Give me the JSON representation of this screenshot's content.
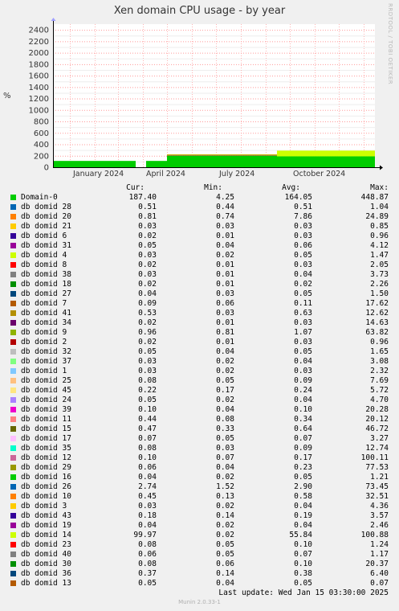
{
  "title": "Xen domain CPU usage - by year",
  "side_label": "RRDTOOL / TOBI OETIKER",
  "footer": "Munin 2.0.33-1",
  "last_update": "Last update:  Wed Jan 15 03:30:00 2025",
  "chart_data": {
    "type": "area",
    "ylabel": "%",
    "ylim": [
      0,
      2500
    ],
    "yticks": [
      0,
      200,
      400,
      600,
      800,
      1000,
      1200,
      1400,
      1600,
      1800,
      2000,
      2200,
      2400
    ],
    "xlim": [
      "2023-12-11",
      "2025-01-15"
    ],
    "xticks": [
      {
        "label": "January 2024",
        "date": "2024-01-01"
      },
      {
        "label": "April 2024",
        "date": "2024-04-01"
      },
      {
        "label": "July 2024",
        "date": "2024-07-01"
      },
      {
        "label": "October 2024",
        "date": "2024-10-01"
      }
    ],
    "grid": true,
    "colors": {
      "background": "#ffffff",
      "grid": "#ff9a9a",
      "domain0": "#00cc00",
      "domid14": "#ccff00",
      "domid6": "#00008f",
      "domid7": "#ccaa00"
    },
    "series_segments": [
      {
        "name": "Domain-0",
        "from": "2023-12-11",
        "to": "2024-03-23",
        "value": 110
      },
      {
        "name": "Domain-0",
        "from": "2024-04-05",
        "to": "2024-05-01",
        "value": 110
      },
      {
        "name": "Domain-0",
        "from": "2024-05-01",
        "to": "2024-09-15",
        "value": 200
      },
      {
        "name": "Domain-0",
        "from": "2024-09-15",
        "to": "2025-01-15",
        "value": 190
      },
      {
        "name": "db domid 6",
        "from": "2024-05-01",
        "to": "2024-09-15",
        "value": 15
      },
      {
        "name": "db domid 14",
        "from": "2024-09-15",
        "to": "2025-01-15",
        "value": 100
      }
    ]
  },
  "legend": {
    "headers": [
      "Cur:",
      "Min:",
      "Avg:",
      "Max:"
    ],
    "rows": [
      {
        "name": "Domain-0",
        "color": "#00cc00",
        "cur": "187.40",
        "min": "4.25",
        "avg": "164.05",
        "max": "448.87"
      },
      {
        "name": "db domid 28",
        "color": "#0066b3",
        "cur": "0.51",
        "min": "0.44",
        "avg": "0.51",
        "max": "1.04"
      },
      {
        "name": "db domid 20",
        "color": "#ff8000",
        "cur": "0.81",
        "min": "0.74",
        "avg": "7.86",
        "max": "24.89"
      },
      {
        "name": "db domid 21",
        "color": "#ffcc00",
        "cur": "0.03",
        "min": "0.03",
        "avg": "0.03",
        "max": "0.85"
      },
      {
        "name": "db domid 6",
        "color": "#330099",
        "cur": "0.02",
        "min": "0.01",
        "avg": "0.03",
        "max": "0.96"
      },
      {
        "name": "db domid 31",
        "color": "#990099",
        "cur": "0.05",
        "min": "0.04",
        "avg": "0.06",
        "max": "4.12"
      },
      {
        "name": "db domid 4",
        "color": "#ccff00",
        "cur": "0.03",
        "min": "0.02",
        "avg": "0.05",
        "max": "1.47"
      },
      {
        "name": "db domid 8",
        "color": "#ff0000",
        "cur": "0.02",
        "min": "0.01",
        "avg": "0.03",
        "max": "2.05"
      },
      {
        "name": "db domid 38",
        "color": "#808080",
        "cur": "0.03",
        "min": "0.01",
        "avg": "0.04",
        "max": "3.73"
      },
      {
        "name": "db domid 18",
        "color": "#008f00",
        "cur": "0.02",
        "min": "0.01",
        "avg": "0.02",
        "max": "2.26"
      },
      {
        "name": "db domid 27",
        "color": "#00487d",
        "cur": "0.04",
        "min": "0.03",
        "avg": "0.05",
        "max": "1.50"
      },
      {
        "name": "db domid 7",
        "color": "#b35a00",
        "cur": "0.09",
        "min": "0.06",
        "avg": "0.11",
        "max": "17.62"
      },
      {
        "name": "db domid 41",
        "color": "#b38f00",
        "cur": "0.53",
        "min": "0.03",
        "avg": "0.63",
        "max": "12.62"
      },
      {
        "name": "db domid 34",
        "color": "#6b006b",
        "cur": "0.02",
        "min": "0.01",
        "avg": "0.03",
        "max": "14.63"
      },
      {
        "name": "db domid 9",
        "color": "#8fb300",
        "cur": "0.96",
        "min": "0.81",
        "avg": "1.07",
        "max": "63.82"
      },
      {
        "name": "db domid 2",
        "color": "#b30000",
        "cur": "0.02",
        "min": "0.01",
        "avg": "0.03",
        "max": "0.96"
      },
      {
        "name": "db domid 32",
        "color": "#bebebe",
        "cur": "0.05",
        "min": "0.04",
        "avg": "0.05",
        "max": "1.65"
      },
      {
        "name": "db domid 37",
        "color": "#80ff80",
        "cur": "0.03",
        "min": "0.02",
        "avg": "0.04",
        "max": "3.08"
      },
      {
        "name": "db domid 1",
        "color": "#80c9ff",
        "cur": "0.03",
        "min": "0.02",
        "avg": "0.03",
        "max": "2.32"
      },
      {
        "name": "db domid 25",
        "color": "#ffc080",
        "cur": "0.08",
        "min": "0.05",
        "avg": "0.09",
        "max": "7.69"
      },
      {
        "name": "db domid 45",
        "color": "#ffe680",
        "cur": "0.22",
        "min": "0.17",
        "avg": "0.24",
        "max": "5.72"
      },
      {
        "name": "db domid 24",
        "color": "#aa80ff",
        "cur": "0.05",
        "min": "0.02",
        "avg": "0.04",
        "max": "4.70"
      },
      {
        "name": "db domid 39",
        "color": "#ee00cc",
        "cur": "0.10",
        "min": "0.04",
        "avg": "0.10",
        "max": "20.28"
      },
      {
        "name": "db domid 11",
        "color": "#ff8080",
        "cur": "0.44",
        "min": "0.08",
        "avg": "0.34",
        "max": "20.12"
      },
      {
        "name": "db domid 15",
        "color": "#666600",
        "cur": "0.47",
        "min": "0.33",
        "avg": "0.64",
        "max": "46.72"
      },
      {
        "name": "db domid 17",
        "color": "#ffbfff",
        "cur": "0.07",
        "min": "0.05",
        "avg": "0.07",
        "max": "3.27"
      },
      {
        "name": "db domid 35",
        "color": "#00ffcc",
        "cur": "0.08",
        "min": "0.03",
        "avg": "0.09",
        "max": "12.74"
      },
      {
        "name": "db domid 12",
        "color": "#cc6699",
        "cur": "0.10",
        "min": "0.07",
        "avg": "0.17",
        "max": "100.11"
      },
      {
        "name": "db domid 29",
        "color": "#999900",
        "cur": "0.06",
        "min": "0.04",
        "avg": "0.23",
        "max": "77.53"
      },
      {
        "name": "db domid 16",
        "color": "#00cc00",
        "cur": "0.04",
        "min": "0.02",
        "avg": "0.05",
        "max": "1.21"
      },
      {
        "name": "db domid 26",
        "color": "#0066b3",
        "cur": "2.74",
        "min": "1.52",
        "avg": "2.90",
        "max": "73.45"
      },
      {
        "name": "db domid 10",
        "color": "#ff8000",
        "cur": "0.45",
        "min": "0.13",
        "avg": "0.58",
        "max": "32.51"
      },
      {
        "name": "db domid 3",
        "color": "#ffcc00",
        "cur": "0.03",
        "min": "0.02",
        "avg": "0.04",
        "max": "4.36"
      },
      {
        "name": "db domid 43",
        "color": "#330099",
        "cur": "0.18",
        "min": "0.14",
        "avg": "0.19",
        "max": "3.57"
      },
      {
        "name": "db domid 19",
        "color": "#990099",
        "cur": "0.04",
        "min": "0.02",
        "avg": "0.04",
        "max": "2.46"
      },
      {
        "name": "db domid 14",
        "color": "#ccff00",
        "cur": "99.97",
        "min": "0.02",
        "avg": "55.84",
        "max": "100.88"
      },
      {
        "name": "db domid 23",
        "color": "#ff0000",
        "cur": "0.08",
        "min": "0.05",
        "avg": "0.10",
        "max": "1.24"
      },
      {
        "name": "db domid 40",
        "color": "#808080",
        "cur": "0.06",
        "min": "0.05",
        "avg": "0.07",
        "max": "1.17"
      },
      {
        "name": "db domid 30",
        "color": "#008f00",
        "cur": "0.08",
        "min": "0.06",
        "avg": "0.10",
        "max": "20.37"
      },
      {
        "name": "db domid 36",
        "color": "#00487d",
        "cur": "0.37",
        "min": "0.14",
        "avg": "0.38",
        "max": "6.40"
      },
      {
        "name": "db domid 13",
        "color": "#b35a00",
        "cur": "0.05",
        "min": "0.04",
        "avg": "0.05",
        "max": "0.07"
      }
    ]
  }
}
